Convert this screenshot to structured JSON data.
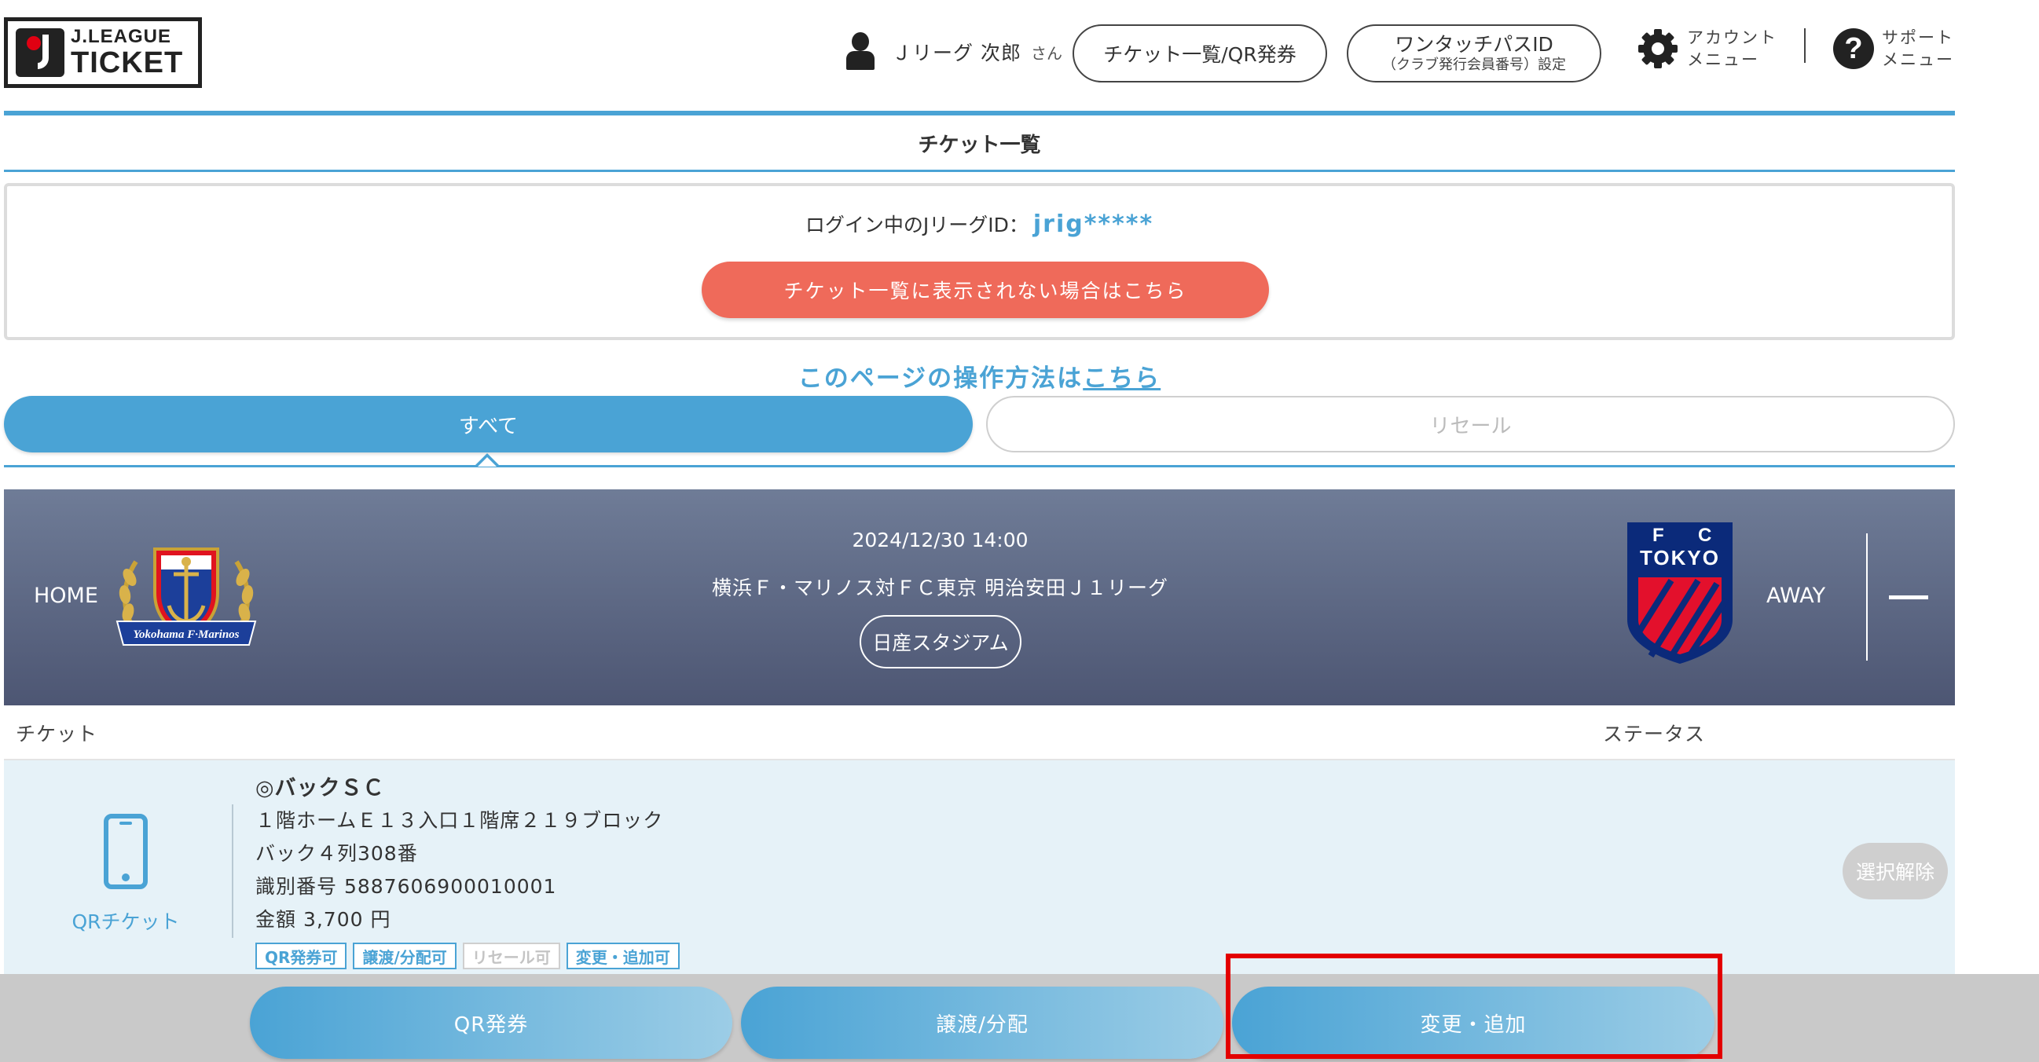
{
  "header": {
    "logo": {
      "line1": "J.LEAGUE",
      "line2": "TICKET"
    },
    "user": {
      "name": "Ｊリーグ 次郎",
      "suffix": "さん"
    },
    "ticket_list_button": "チケット一覧/QR発券",
    "one_touch_pass": {
      "title": "ワンタッチパスID",
      "subtitle": "（クラブ発行会員番号）設定"
    },
    "account_menu": {
      "line1": "アカウント",
      "line2": "メニュー"
    },
    "support_menu": {
      "line1": "サポート",
      "line2": "メニュー"
    }
  },
  "page": {
    "title": "チケット一覧",
    "login_label": "ログイン中のJリーグID：",
    "login_id": "jrig*****",
    "not_shown_button": "チケット一覧に表示されない場合はこちら",
    "howto_text": "このページの操作方法は",
    "howto_link": "こちら"
  },
  "tabs": [
    {
      "label": "すべて",
      "active": true
    },
    {
      "label": "リセール",
      "active": false
    }
  ],
  "match": {
    "home_label": "HOME",
    "away_label": "AWAY",
    "datetime": "2024/12/30 14:00",
    "name": "横浜Ｆ・マリノス対ＦＣ東京 明治安田Ｊ１リーグ",
    "venue": "日産スタジアム",
    "home_crest_text": "Yokohama F·Marinos",
    "away_crest_text": {
      "f": "F",
      "c": "C",
      "tokyo": "TOKYO"
    }
  },
  "table": {
    "col_ticket": "チケット",
    "col_status": "ステータス"
  },
  "ticket": {
    "type_label": "QRチケット",
    "seat_type": "◎バックＳＣ",
    "location": "１階ホームＥ１３入口１階席２１９ブロック",
    "seat": "バック４列308番",
    "id_line": "識別番号 5887606900010001",
    "price_line": "金額 3,700 円",
    "tags": [
      {
        "label": "QR発券可",
        "enabled": true
      },
      {
        "label": "譲渡/分配可",
        "enabled": true
      },
      {
        "label": "リセール可",
        "enabled": false
      },
      {
        "label": "変更・追加可",
        "enabled": true
      }
    ],
    "deselect_button": "選択解除"
  },
  "actions": {
    "qr": "QR発券",
    "transfer": "譲渡/分配",
    "change": "変更・追加"
  },
  "colors": {
    "accent": "#4aa3d5",
    "alert_button": "#ef6a5a",
    "highlight": "#e30000",
    "banner": "#5c6682"
  }
}
